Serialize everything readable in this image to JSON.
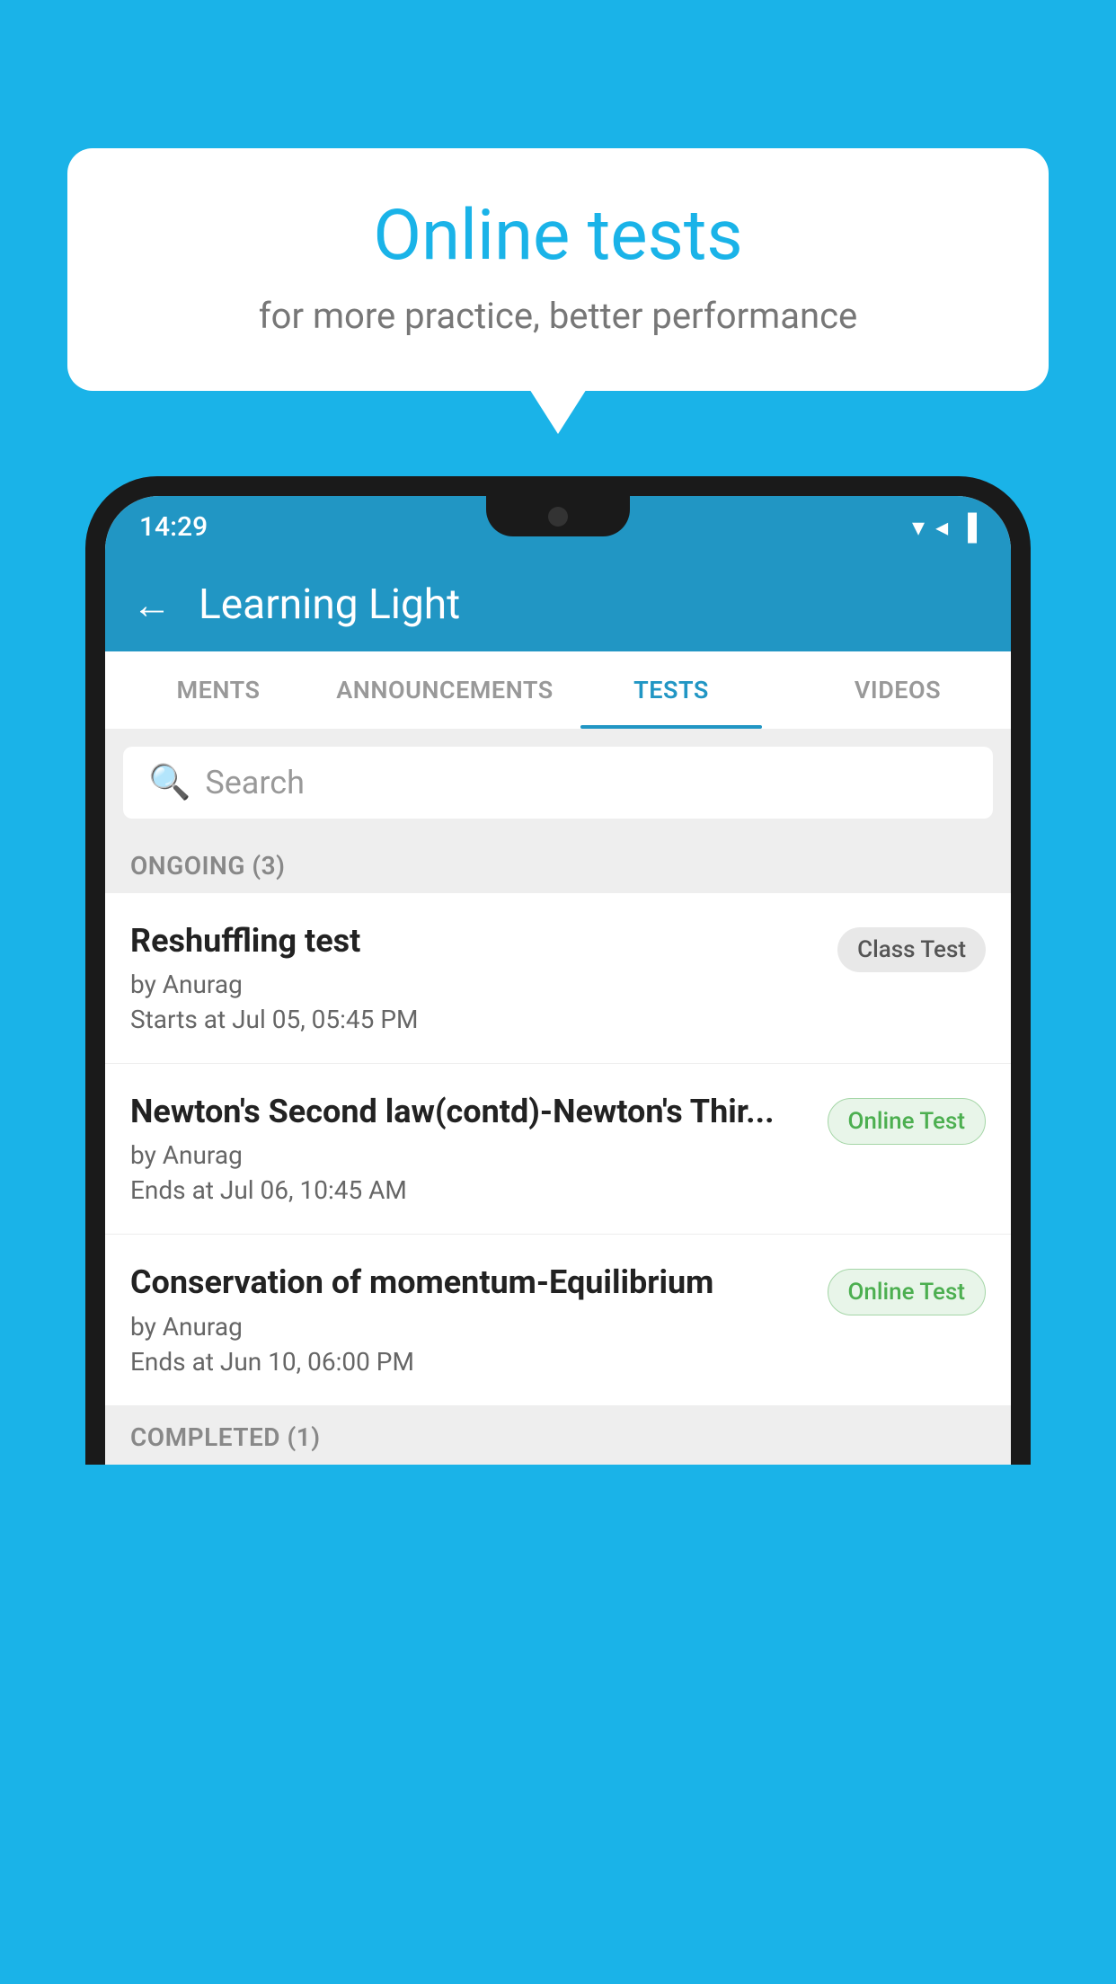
{
  "background_color": "#1ab3e8",
  "speech_bubble": {
    "title": "Online tests",
    "subtitle": "for more practice, better performance"
  },
  "status_bar": {
    "time": "14:29",
    "icons": [
      "▾",
      "◂",
      "▐"
    ]
  },
  "app_bar": {
    "back_arrow": "←",
    "title": "Learning Light"
  },
  "tabs": [
    {
      "label": "MENTS",
      "active": false
    },
    {
      "label": "ANNOUNCEMENTS",
      "active": false
    },
    {
      "label": "TESTS",
      "active": true
    },
    {
      "label": "VIDEOS",
      "active": false
    }
  ],
  "search": {
    "placeholder": "Search"
  },
  "sections": [
    {
      "header": "ONGOING (3)",
      "items": [
        {
          "title": "Reshuffling test",
          "author": "by Anurag",
          "date": "Starts at  Jul 05, 05:45 PM",
          "badge": "Class Test",
          "badge_type": "class"
        },
        {
          "title": "Newton's Second law(contd)-Newton's Thir...",
          "author": "by Anurag",
          "date": "Ends at  Jul 06, 10:45 AM",
          "badge": "Online Test",
          "badge_type": "online"
        },
        {
          "title": "Conservation of momentum-Equilibrium",
          "author": "by Anurag",
          "date": "Ends at  Jun 10, 06:00 PM",
          "badge": "Online Test",
          "badge_type": "online"
        }
      ]
    },
    {
      "header": "COMPLETED (1)",
      "items": []
    }
  ]
}
